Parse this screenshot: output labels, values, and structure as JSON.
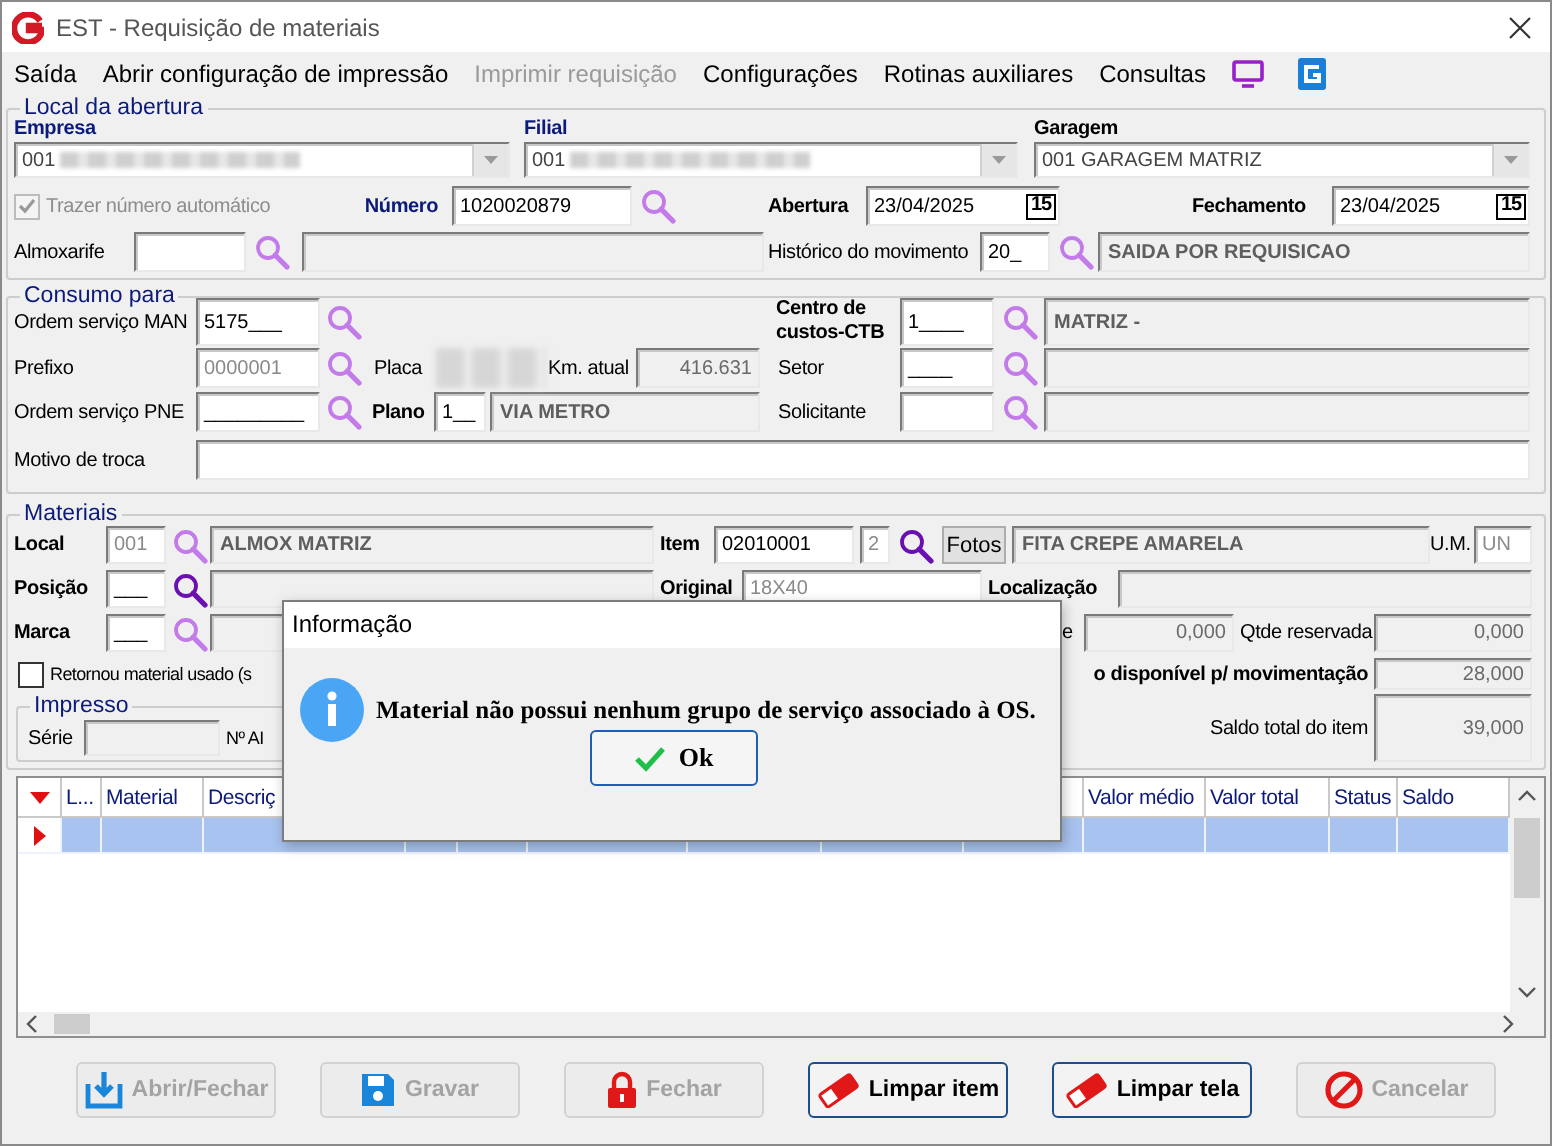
{
  "window": {
    "title": "EST - Requisição de materiais"
  },
  "menu": [
    {
      "label": "Saída",
      "disabled": false
    },
    {
      "label": "Abrir configuração de impressão",
      "disabled": false
    },
    {
      "label": "Imprimir requisição",
      "disabled": true
    },
    {
      "label": "Configurações",
      "disabled": false
    },
    {
      "label": "Rotinas auxiliares",
      "disabled": false
    },
    {
      "label": "Consultas",
      "disabled": false
    }
  ],
  "groups": [
    {
      "title": "Local da abertura",
      "fields": [
        {
          "kind": "key-label",
          "text": "Empresa"
        },
        {
          "kind": "key-label",
          "text": "Filial"
        },
        {
          "kind": "bold-label",
          "text": "Garagem"
        },
        {
          "kind": "combo",
          "value": "001",
          "redacted": true
        },
        {
          "kind": "combo",
          "value": "001",
          "redacted": true
        },
        {
          "kind": "combo",
          "value": "001 GARAGEM MATRIZ",
          "redacted": false
        },
        {
          "kind": "check",
          "label": "Trazer número automático",
          "checked": true,
          "disabled": true
        },
        {
          "kind": "key-label",
          "text": "Número"
        },
        {
          "kind": "input",
          "value": "1020020879",
          "disabled": false
        },
        {
          "kind": "lookup",
          "active": false
        },
        {
          "kind": "bold-label",
          "text": "Abertura"
        },
        {
          "kind": "date",
          "value": "23/04/2025",
          "day": "15"
        },
        {
          "kind": "bold-label",
          "text": "Fechamento"
        },
        {
          "kind": "date",
          "value": "23/04/2025",
          "day": "15"
        },
        {
          "kind": "label",
          "text": "Almoxarife"
        },
        {
          "kind": "input"
        },
        {
          "kind": "lookup",
          "active": false
        },
        {
          "kind": "readonly"
        },
        {
          "kind": "label",
          "text": "Histórico do movimento"
        },
        {
          "kind": "input",
          "value": "20_",
          "disabled": false
        },
        {
          "kind": "lookup",
          "active": false
        },
        {
          "kind": "readonly",
          "value": "SAIDA POR REQUISICAO"
        }
      ]
    },
    {
      "title": "Consumo para",
      "fields": [
        {
          "kind": "label",
          "text": "Ordem serviço MAN"
        },
        {
          "kind": "input",
          "value": "5175___",
          "disabled": false
        },
        {
          "kind": "lookup",
          "active": false
        },
        {
          "kind": "bold-label",
          "text": "Centro de custos-CTB"
        },
        {
          "kind": "input",
          "value": "1____",
          "disabled": false
        },
        {
          "kind": "lookup",
          "active": false
        },
        {
          "kind": "readonly",
          "value": "MATRIZ -"
        },
        {
          "kind": "label",
          "text": "Prefixo"
        },
        {
          "kind": "input",
          "value": "0000001",
          "disabled": true
        },
        {
          "kind": "lookup",
          "active": false
        },
        {
          "kind": "label",
          "text": "Placa"
        },
        {
          "kind": "redacted"
        },
        {
          "kind": "label",
          "text": "Km. atual"
        },
        {
          "kind": "number",
          "value": "416.631"
        },
        {
          "kind": "label",
          "text": "Setor"
        },
        {
          "kind": "input",
          "value": "____",
          "disabled": false
        },
        {
          "kind": "lookup",
          "active": false
        },
        {
          "kind": "readonly"
        },
        {
          "kind": "label",
          "text": "Ordem serviço PNE"
        },
        {
          "kind": "input",
          "value": "_________",
          "disabled": false
        },
        {
          "kind": "lookup",
          "active": false
        },
        {
          "kind": "bold-label",
          "text": "Plano"
        },
        {
          "kind": "input",
          "value": "1__",
          "disabled": false
        },
        {
          "kind": "readonly",
          "value": "VIA METRO"
        },
        {
          "kind": "label",
          "text": "Solicitante"
        },
        {
          "kind": "input"
        },
        {
          "kind": "lookup",
          "active": false
        },
        {
          "kind": "readonly"
        },
        {
          "kind": "label",
          "text": "Motivo de troca"
        },
        {
          "kind": "input"
        }
      ]
    },
    {
      "title": "Materiais",
      "fields": [
        {
          "kind": "bold-label",
          "text": "Local"
        },
        {
          "kind": "input",
          "value": "001",
          "disabled": true
        },
        {
          "kind": "lookup",
          "active": false
        },
        {
          "kind": "readonly",
          "value": "ALMOX MATRIZ"
        },
        {
          "kind": "bold-label",
          "text": "Item"
        },
        {
          "kind": "input",
          "value": "02010001",
          "disabled": false
        },
        {
          "kind": "input",
          "value": "2",
          "disabled": true
        },
        {
          "kind": "lookup",
          "active": true
        },
        {
          "kind": "button",
          "label": "Fotos"
        },
        {
          "kind": "readonly",
          "value": "FITA CREPE AMARELA"
        },
        {
          "kind": "label",
          "text": "U.M."
        },
        {
          "kind": "input",
          "value": "UN",
          "disabled": true
        },
        {
          "kind": "bold-label",
          "text": "Posição"
        },
        {
          "kind": "input",
          "value": "___",
          "disabled": false
        },
        {
          "kind": "lookup",
          "active": true
        },
        {
          "kind": "readonly"
        },
        {
          "kind": "bold-label",
          "text": "Original"
        },
        {
          "kind": "input",
          "value": "18X40",
          "disabled": true
        },
        {
          "kind": "bold-label",
          "text": "Localização"
        },
        {
          "kind": "readonly"
        },
        {
          "kind": "bold-label",
          "text": "Marca"
        },
        {
          "kind": "input",
          "value": "___",
          "disabled": false
        },
        {
          "kind": "lookup",
          "active": false
        },
        {
          "kind": "readonly"
        },
        {
          "kind": "label",
          "text": "e"
        },
        {
          "kind": "number",
          "value": "0,000"
        },
        {
          "kind": "label",
          "text": "Qtde reservada"
        },
        {
          "kind": "number",
          "value": "0,000"
        },
        {
          "kind": "check",
          "label": "Retornou material usado (s",
          "checked": false,
          "disabled": false
        },
        {
          "kind": "bold-label",
          "text": "o disponível p/ movimentação"
        },
        {
          "kind": "number",
          "value": "28,000"
        },
        {
          "kind": "subgroup",
          "title": "Impresso",
          "fields": [
            {
              "kind": "label",
              "text": "Série"
            },
            {
              "kind": "readonly"
            },
            {
              "kind": "label",
              "text": "Nº AI"
            }
          ]
        },
        {
          "kind": "label",
          "text": "Saldo total do item"
        },
        {
          "kind": "number",
          "value": "39,000"
        }
      ]
    }
  ],
  "table": {
    "columns": [
      {
        "label": "L..."
      },
      {
        "label": "Material"
      },
      {
        "label": "Descriç"
      },
      {
        "label": "Valor médio"
      },
      {
        "label": "Valor total"
      },
      {
        "label": "Status"
      },
      {
        "label": "Saldo"
      }
    ],
    "rows": [
      {
        "selected": true
      }
    ]
  },
  "buttons": [
    {
      "label": "Abrir/Fechar",
      "disabled": true
    },
    {
      "label": "Gravar",
      "disabled": true
    },
    {
      "label": "Fechar",
      "disabled": true
    },
    {
      "label": "Limpar item",
      "disabled": false
    },
    {
      "label": "Limpar tela",
      "disabled": false
    },
    {
      "label": "Cancelar",
      "disabled": true
    }
  ],
  "dialog": {
    "title": "Informação",
    "message": "Material não possui nenhum grupo de serviço associado à OS.",
    "button": "Ok"
  }
}
